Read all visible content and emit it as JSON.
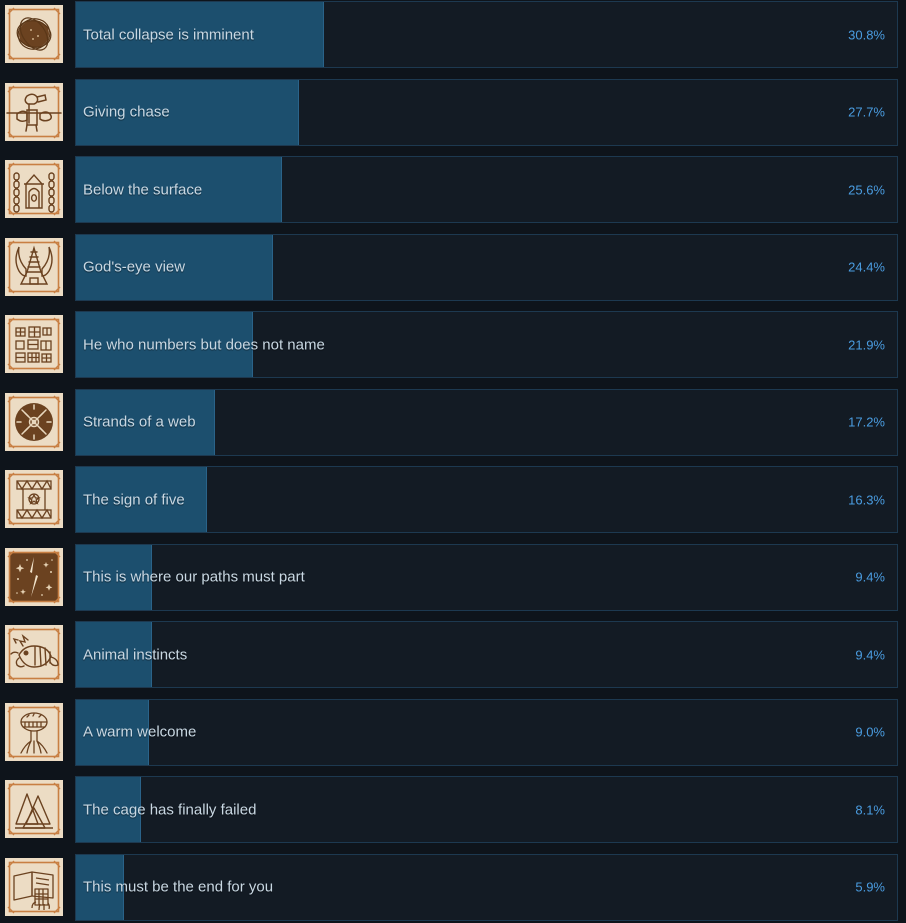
{
  "page": {
    "background_color": "#0e141b",
    "bar_track_color": "#131b24",
    "bar_fill_color": "#1c4f6e",
    "bar_border_color": "#1d3950",
    "title_text_color": "#c9d8e3",
    "percent_text_color": "#4a9ce0",
    "icon_parchment_color": "#ecdcc4",
    "icon_ink_color": "#6b4220",
    "icon_frame_color": "#c87f43"
  },
  "chart_data": {
    "type": "bar",
    "title": "",
    "xlabel": "",
    "ylabel": "",
    "xlim": [
      0,
      100
    ],
    "grid": false,
    "orientation": "horizontal",
    "unit": "%",
    "categories": [
      "Total collapse is imminent",
      "Giving chase",
      "Below the surface",
      "God's-eye view",
      "He who numbers but does not name",
      "Strands of a web",
      "The sign of five",
      "This is where our paths must part",
      "Animal instincts",
      "A warm welcome",
      "The cage has finally failed",
      "This must be the end for you"
    ],
    "values": [
      30.8,
      27.7,
      25.6,
      24.4,
      21.9,
      17.2,
      16.3,
      9.4,
      9.4,
      9.0,
      8.1,
      5.9
    ]
  },
  "achievements": [
    {
      "name": "Total collapse is imminent",
      "percent_label": "30.8%",
      "percent_value": 30.8,
      "icon_name": "tangled-ball-icon",
      "icon_style": "dark"
    },
    {
      "name": "Giving chase",
      "percent_label": "27.7%",
      "percent_value": 27.7,
      "icon_name": "running-figure-icon",
      "icon_style": "light"
    },
    {
      "name": "Below the surface",
      "percent_label": "25.6%",
      "percent_value": 25.6,
      "icon_name": "chained-doorway-icon",
      "icon_style": "light"
    },
    {
      "name": "God's-eye view",
      "percent_label": "24.4%",
      "percent_value": 24.4,
      "icon_name": "winged-tower-icon",
      "icon_style": "light"
    },
    {
      "name": "He who numbers but does not name",
      "percent_label": "21.9%",
      "percent_value": 21.9,
      "icon_name": "grid-blocks-icon",
      "icon_style": "light"
    },
    {
      "name": "Strands of a web",
      "percent_label": "17.2%",
      "percent_value": 17.2,
      "icon_name": "spiderweb-disc-icon",
      "icon_style": "dark"
    },
    {
      "name": "The sign of five",
      "percent_label": "16.3%",
      "percent_value": 16.3,
      "icon_name": "banner-star-icon",
      "icon_style": "light"
    },
    {
      "name": "This is where our paths must part",
      "percent_label": "9.4%",
      "percent_value": 9.4,
      "icon_name": "lightning-rift-icon",
      "icon_style": "dark"
    },
    {
      "name": "Animal instincts",
      "percent_label": "9.4%",
      "percent_value": 9.4,
      "icon_name": "beast-head-icon",
      "icon_style": "light"
    },
    {
      "name": "A warm welcome",
      "percent_label": "9.0%",
      "percent_value": 9.0,
      "icon_name": "tree-roots-icon",
      "icon_style": "light"
    },
    {
      "name": "The cage has finally failed",
      "percent_label": "8.1%",
      "percent_value": 8.1,
      "icon_name": "triangle-cage-icon",
      "icon_style": "light"
    },
    {
      "name": "This must be the end for you",
      "percent_label": "5.9%",
      "percent_value": 5.9,
      "icon_name": "open-book-hand-icon",
      "icon_style": "light"
    }
  ]
}
